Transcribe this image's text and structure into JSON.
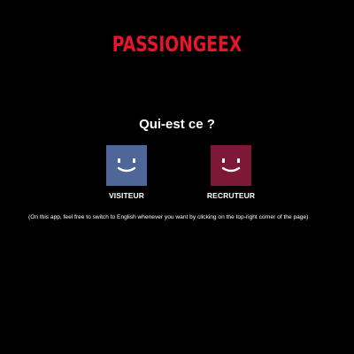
{
  "brand": {
    "logo_text": "PASSIONGEEX",
    "accent_color": "#e8142a"
  },
  "prompt": {
    "question": "Qui-est ce ?"
  },
  "profiles": [
    {
      "label": "VISITEUR",
      "icon": "smiley-face-icon",
      "color": "#4f6698"
    },
    {
      "label": "RECRUTEUR",
      "icon": "smiley-face-icon",
      "color": "#7e1839"
    }
  ],
  "language_note": "(On this app, feel free to switch to English whenever you want by clicking on the top-right corner of the page)"
}
